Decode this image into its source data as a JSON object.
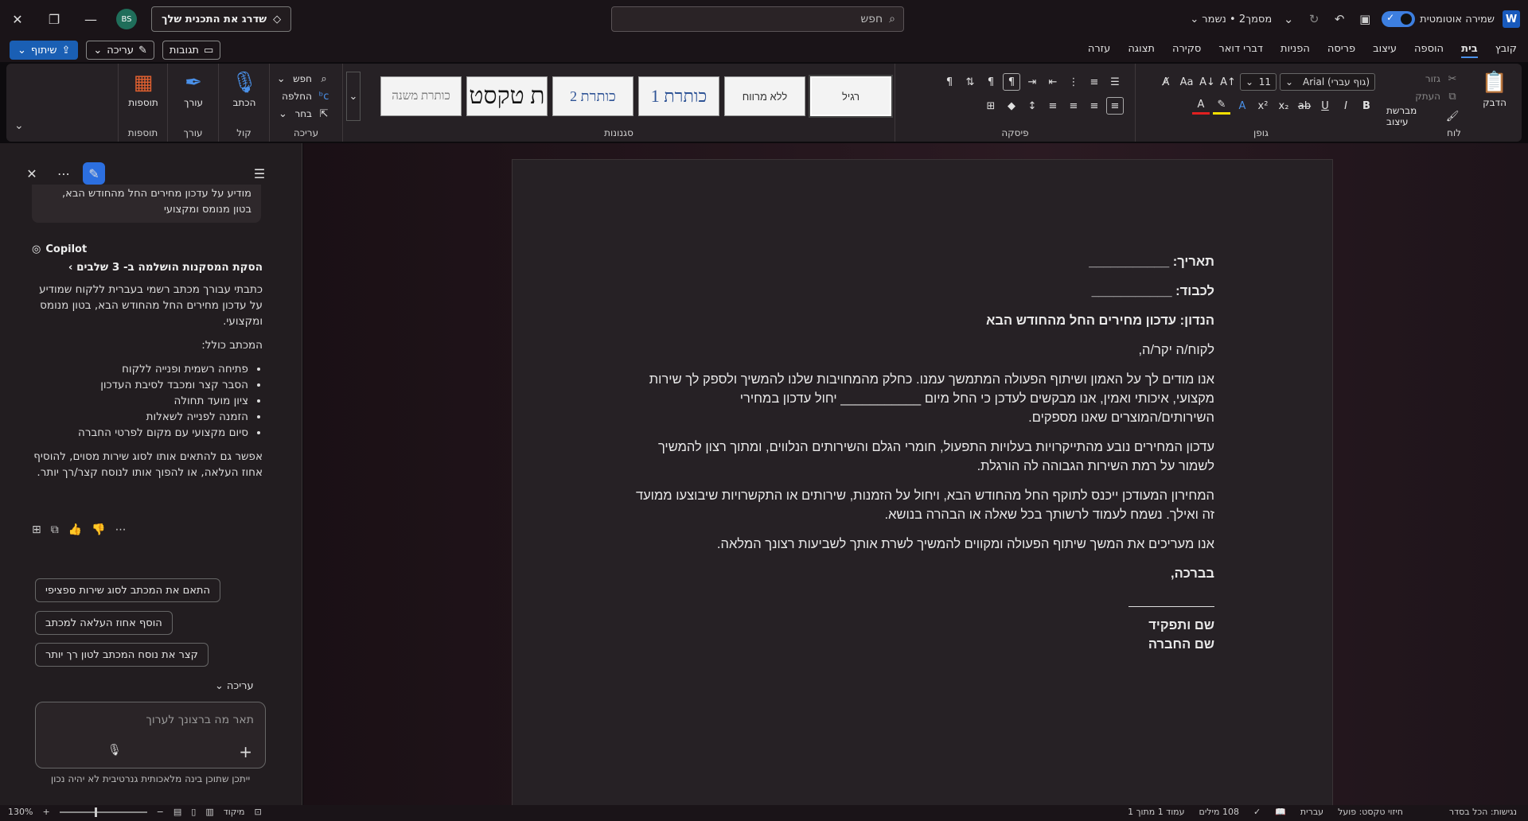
{
  "app": {
    "autosave_label": "שמירה אוטומטית",
    "doc_title": "מסמך2 • נשמר",
    "search_placeholder": "חפש",
    "upgrade_label": "שדרג את התכנית שלך",
    "avatar_initials": "BS"
  },
  "menu": {
    "tabs": [
      "קובץ",
      "בית",
      "הוספה",
      "עיצוב",
      "פריסה",
      "הפניות",
      "דברי דואר",
      "סקירה",
      "תצוגה",
      "עזרה"
    ],
    "active_tab": "בית",
    "share_label": "שיתוף",
    "edit_label": "עריכה",
    "comments_label": "תגובות"
  },
  "ribbon": {
    "clipboard": {
      "label": "לוח",
      "paste": "הדבק",
      "cut": "גזור",
      "copy": "העתק",
      "format_painter": "מברשת עיצוב"
    },
    "font": {
      "label": "גופן",
      "font_name": "Arial (גוף עברי)",
      "font_size": "11"
    },
    "paragraph": {
      "label": "פיסקה"
    },
    "styles": {
      "label": "סגנונות",
      "items": [
        "רגיל",
        "ללא מרווח",
        "כותרת 1",
        "כותרת 2",
        "ת טקסט",
        "כותרת משנה"
      ]
    },
    "editing": {
      "label": "עריכה",
      "find": "חפש",
      "replace": "החלפה",
      "select": "בחר"
    },
    "voice": {
      "label": "קול",
      "dictate": "הכתב"
    },
    "editor": {
      "label": "עורך",
      "editor_btn": "עורך"
    },
    "addins": {
      "label": "תוספות",
      "addins_btn": "תוספות"
    }
  },
  "copilot": {
    "prev_message": "מודיע על עדכון מחירים החל מהחודש הבא, בטון מנומס ומקצועי",
    "brand": "Copilot",
    "steps_label": "הסקת המסקנות הושלמה ב- 3 שלבים",
    "intro": "כתבתי עבורך מכתב רשמי בעברית ללקוח שמודיע על עדכון מחירים החל מהחודש הבא, בטון מנומס ומקצועי.",
    "includes_label": "המכתב כולל:",
    "bullets": [
      "פתיחה רשמית ופנייה ללקוח",
      "הסבר קצר ומכבד לסיבת העדכון",
      "ציון מועד תחולה",
      "הזמנה לפנייה לשאלות",
      "סיום מקצועי עם מקום לפרטי החברה"
    ],
    "followup": "אפשר גם להתאים אותו לסוג שירות מסוים, להוסיף אחוז העלאה, או להפוך אותו לנוסח קצר/רך יותר.",
    "chips": [
      "התאם את המכתב לסוג שירות ספציפי",
      "הוסף אחוז העלאה למכתב",
      "קצר את נוסח המכתב לטון רך יותר"
    ],
    "edit_mode": "עריכה",
    "input_placeholder": "תאר מה ברצונך לערוך",
    "disclaimer": "ייתכן שתוכן בינה מלאכותית גנרטיבית לא יהיה נכון"
  },
  "document": {
    "date_label": "תאריך: ___________",
    "to_label": "לכבוד: ___________",
    "subject": "הנדון: עדכון מחירים החל מהחודש הבא",
    "greeting": "לקוח/ה יקר/ה,",
    "p1": "אנו מודים לך על האמון ושיתוף הפעולה המתמשך עמנו. כחלק מהמחויבות שלנו להמשיך ולספק לך שירות מקצועי, איכותי ואמין, אנו מבקשים לעדכן כי החל מיום ___________ יחול עדכון במחירי השירותים/המוצרים שאנו מספקים.",
    "p2": "עדכון המחירים נובע מהתייקרויות בעלויות התפעול, חומרי הגלם והשירותים הנלווים, ומתוך רצון להמשיך לשמור על רמת השירות הגבוהה לה הורגלת.",
    "p3": "המחירון המעודכן ייכנס לתוקף החל מהחודש הבא, ויחול על הזמנות, שירותים או התקשרויות שיבוצעו ממועד זה ואילך. נשמח לעמוד לרשותך בכל שאלה או הבהרה בנושא.",
    "p4": "אנו מעריכים את המשך שיתוף הפעולה ומקווים להמשיך לשרת אותך לשביעות רצונך המלאה.",
    "closing": "בברכה,",
    "sig_name": "שם ותפקיד",
    "sig_company": "שם החברה"
  },
  "status": {
    "page": "עמוד 1 מתוך 1",
    "words": "108 מילים",
    "language": "עברית",
    "text_predictions": "חיזוי טקסט: פועל",
    "accessibility": "נגישות: הכל בסדר",
    "focus": "מיקוד",
    "zoom": "130%"
  }
}
